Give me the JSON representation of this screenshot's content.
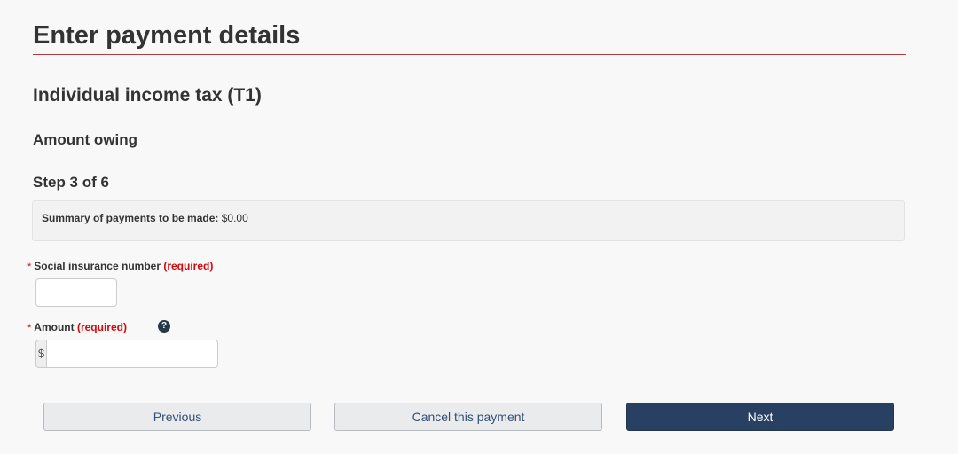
{
  "page": {
    "title": "Enter payment details",
    "subtitle": "Individual income tax (T1)",
    "section_heading": "Amount owing",
    "step": "Step 3 of 6"
  },
  "summary": {
    "label": "Summary of payments to be made:",
    "value": "$0.00"
  },
  "fields": {
    "sin": {
      "asterisk": "*",
      "label": "Social insurance number",
      "required_text": "(required)",
      "value": ""
    },
    "amount": {
      "asterisk": "*",
      "label": "Amount",
      "required_text": "(required)",
      "currency_symbol": "$",
      "help_icon": "?",
      "value": ""
    }
  },
  "buttons": {
    "previous": "Previous",
    "cancel": "Cancel this payment",
    "next": "Next"
  },
  "colors": {
    "rule_accent": "#af3c43",
    "required_red": "#d3080c",
    "primary_button": "#284162"
  },
  "icons": {
    "help": "question-circle-icon"
  }
}
